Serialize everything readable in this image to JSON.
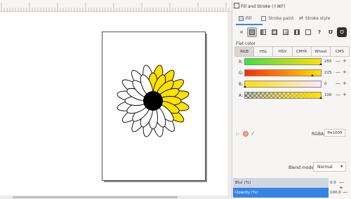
{
  "panel": {
    "title": "Fill and Stroke (⇧⌘F)",
    "tabs": [
      {
        "label": "Fill",
        "icon": "fill-icon"
      },
      {
        "label": "Stroke paint",
        "icon": "stroke-paint-icon"
      },
      {
        "label": "Stroke style",
        "icon": "stroke-style-icon"
      }
    ],
    "paint_types": [
      {
        "name": "no-paint",
        "glyph": "×"
      },
      {
        "name": "flat-color",
        "glyph": ""
      },
      {
        "name": "linear-gradient",
        "glyph": ""
      },
      {
        "name": "radial-gradient",
        "glyph": ""
      },
      {
        "name": "mesh-gradient",
        "glyph": ""
      },
      {
        "name": "pattern",
        "glyph": ""
      },
      {
        "name": "swatch",
        "glyph": ""
      },
      {
        "name": "unset",
        "glyph": "?"
      },
      {
        "name": "fill-rule-evenodd",
        "glyph": "Ʊ"
      },
      {
        "name": "fill-rule-nonzero",
        "glyph": "Ʊ"
      }
    ],
    "flat_color_label": "Flat color",
    "color_modes": [
      "RGB",
      "HSL",
      "HSV",
      "CMYK",
      "Wheel",
      "CMS"
    ],
    "active_mode": "RGB",
    "channels": [
      {
        "label": "R:",
        "value": "255"
      },
      {
        "label": "G:",
        "value": "225"
      },
      {
        "label": "B:",
        "value": "0"
      },
      {
        "label": "A:",
        "value": "100"
      }
    ],
    "rgba_label": "RGBA:",
    "rgba_value": "ffe100ff",
    "blend_label": "Blend mode:",
    "blend_value": "Normal",
    "blur_label": "Blur (%)",
    "blur_value": "0.0",
    "opacity_label": "Opacity (%)",
    "opacity_value": "100.0",
    "colors": {
      "accent": "#3584e4",
      "fill_color": "#ffe100"
    }
  }
}
